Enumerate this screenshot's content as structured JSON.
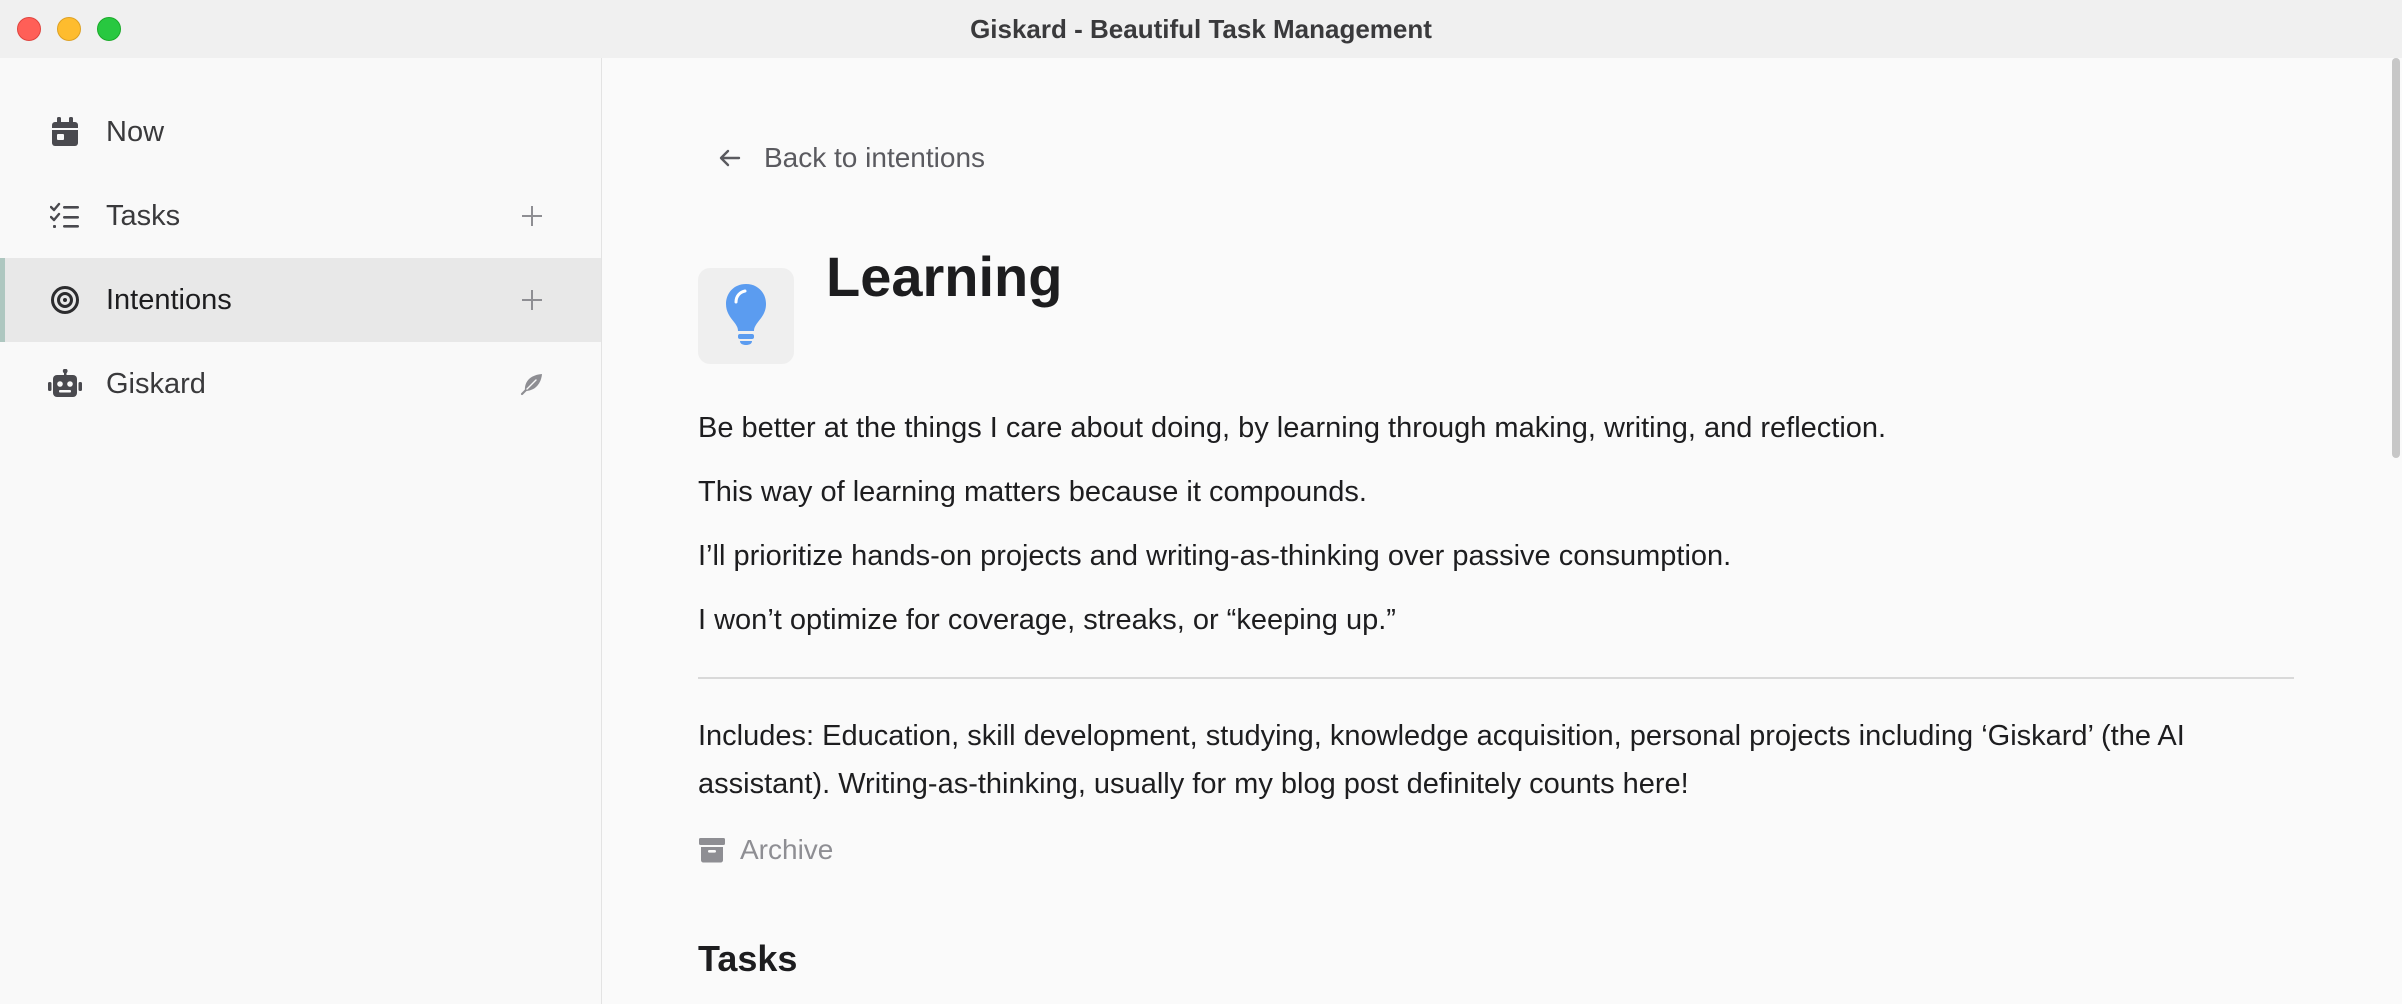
{
  "window": {
    "title": "Giskard - Beautiful Task Management"
  },
  "sidebar": {
    "items": [
      {
        "label": "Now",
        "icon": "calendar-icon",
        "action": null
      },
      {
        "label": "Tasks",
        "icon": "checklist-icon",
        "action": "plus-icon"
      },
      {
        "label": "Intentions",
        "icon": "target-icon",
        "action": "plus-icon",
        "active": true
      },
      {
        "label": "Giskard",
        "icon": "robot-icon",
        "action": "feather-icon"
      }
    ]
  },
  "main": {
    "back_label": "Back to intentions",
    "intention": {
      "icon": "lightbulb-icon",
      "title": "Learning",
      "description": [
        "Be better at the things I care about doing, by learning through making, writing, and reflection.",
        "This way of learning matters because it compounds.",
        "I’ll prioritize hands-on projects and writing-as-thinking over passive consumption.",
        "I won’t optimize for coverage, streaks, or “keeping up.”"
      ],
      "includes": "Includes: Education, skill development, studying, knowledge acquisition, personal projects including ‘Giskard’ (the AI assistant). Writing-as-thinking, usually for my blog post definitely counts here!",
      "archive_label": "Archive"
    },
    "tasks_heading": "Tasks"
  },
  "colors": {
    "accent_active_border": "#aec7c0",
    "lightbulb": "#5b9cf0",
    "traffic_close": "#ff5f57",
    "traffic_min": "#febc2e",
    "traffic_max": "#28c840"
  }
}
